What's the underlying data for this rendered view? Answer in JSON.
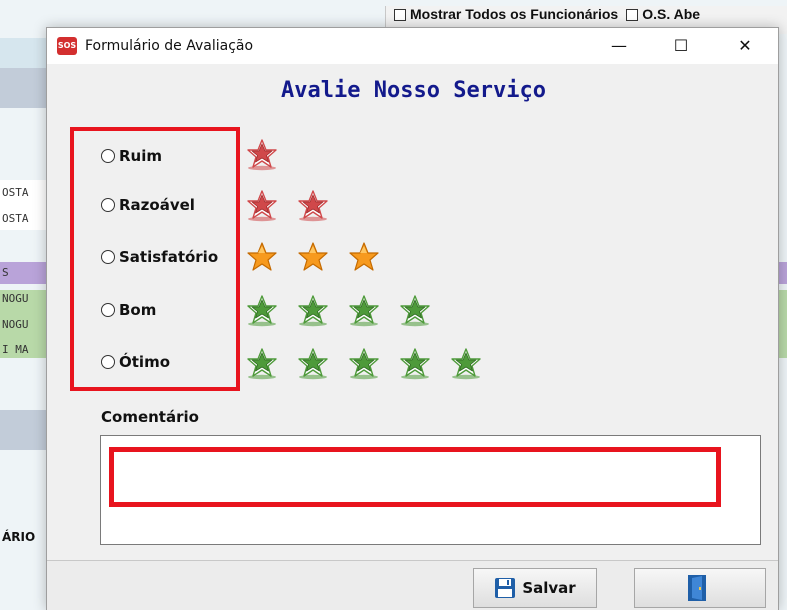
{
  "background": {
    "toolbar_text": "Mostrar Todos os Funcionários",
    "toolbar_text2": "O.S. Abe",
    "rows": [
      "OSTA",
      "OSTA",
      "S",
      "NOGU",
      "NOGU",
      "I MA",
      "ÁRIO"
    ]
  },
  "window": {
    "title": "Formulário de Avaliação",
    "app_icon_label": "SOS",
    "minimize": "—",
    "maximize": "☐",
    "close": "✕"
  },
  "heading": "Avalie Nosso Serviço",
  "ratings": [
    {
      "label": "Ruim",
      "stars": 1,
      "color": "red"
    },
    {
      "label": "Razoável",
      "stars": 2,
      "color": "red"
    },
    {
      "label": "Satisfatório",
      "stars": 3,
      "color": "orange"
    },
    {
      "label": "Bom",
      "stars": 4,
      "color": "green"
    },
    {
      "label": "Ótimo",
      "stars": 5,
      "color": "green"
    }
  ],
  "comment": {
    "label": "Comentário",
    "value": ""
  },
  "buttons": {
    "save": "Salvar",
    "save_icon": "floppy-disk-icon",
    "exit_icon": "exit-door-icon"
  },
  "colors": {
    "highlight_red": "#e8141e",
    "heading_blue": "#131a8c",
    "star_red": "#d0484a",
    "star_orange": "#f79a1e",
    "star_green": "#4e9a3a"
  }
}
